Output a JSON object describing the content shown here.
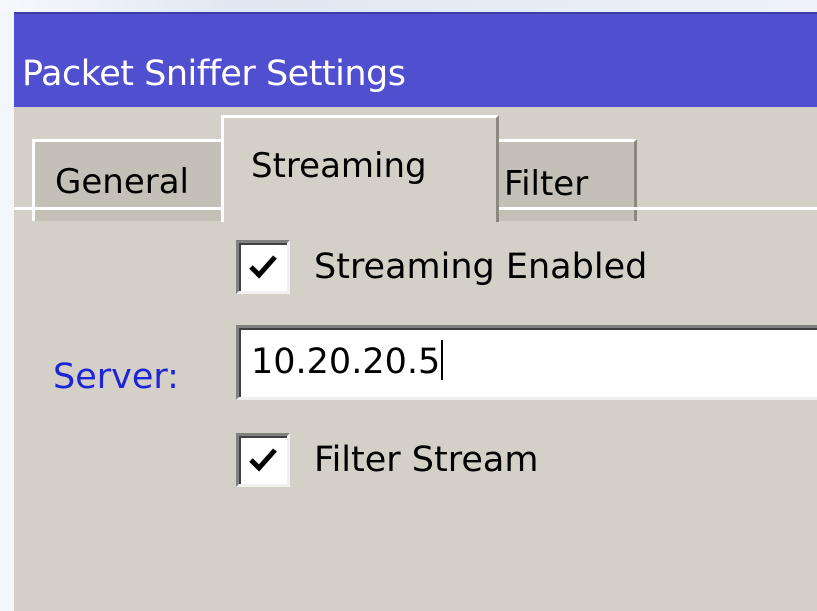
{
  "window": {
    "title": "Packet Sniffer Settings"
  },
  "tabs": [
    {
      "label": "General",
      "active": false
    },
    {
      "label": "Streaming",
      "active": true
    },
    {
      "label": "Filter",
      "active": false
    }
  ],
  "streaming": {
    "streaming_enabled": {
      "label": "Streaming Enabled",
      "checked": true
    },
    "server": {
      "label": "Server:",
      "value": "10.20.20.5"
    },
    "filter_stream": {
      "label": "Filter Stream",
      "checked": true
    }
  },
  "colors": {
    "titlebar": "#4f4fcf",
    "panel": "#d4d0c8",
    "server_label": "#1d24d6"
  },
  "icons": {
    "checkmark": "checkmark-icon"
  }
}
